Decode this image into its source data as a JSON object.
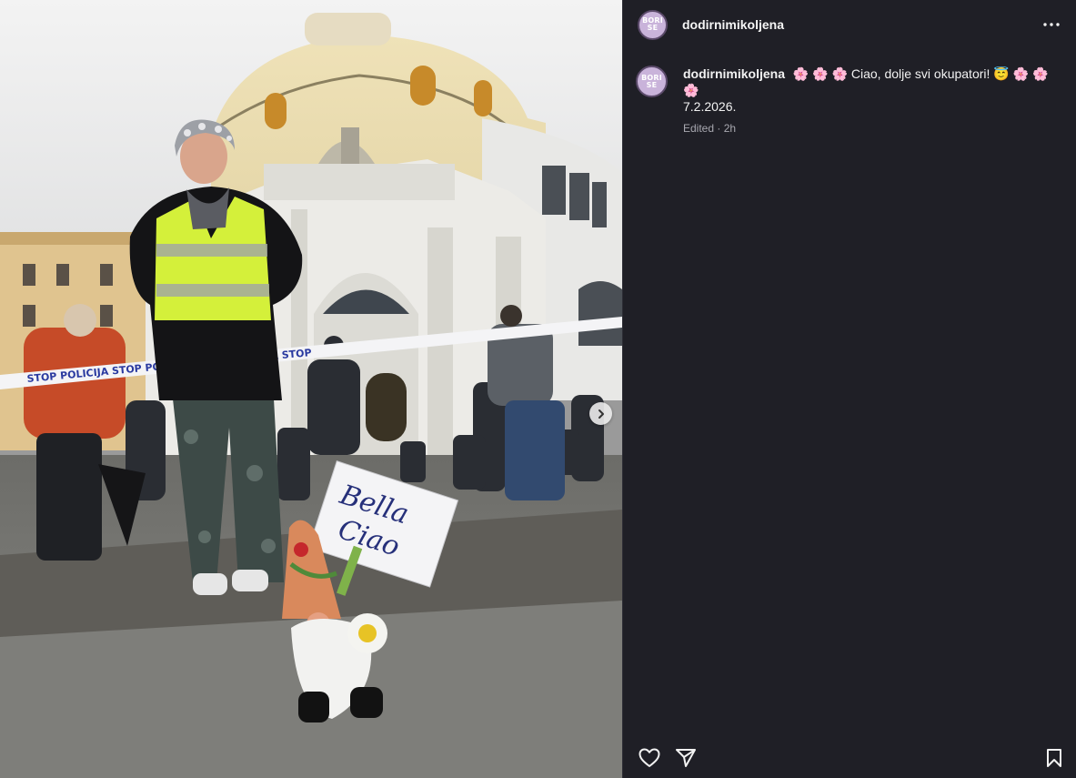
{
  "post": {
    "username": "dodirnimikoljena",
    "avatar_text": [
      "BORI",
      "SE"
    ],
    "caption": {
      "emoji_prefix": "🌸 🌸 🌸",
      "text": "Ciao, dolje svi okupatori!",
      "emoji_suffix": "😇 🌸 🌸",
      "emoji_line2": "🌸",
      "date": "7.2.2026."
    },
    "edited_label": "Edited",
    "time_ago": "2h"
  },
  "photo": {
    "sign_text_line1": "Bella",
    "sign_text_line2": "Ciao",
    "tape_text": "STOP POLICIJA STOP POLICIJA STOP POLICIJA STOP"
  },
  "icons": {
    "more": "more-dots-icon",
    "next": "chevron-right-icon",
    "like": "heart-icon",
    "share": "send-icon",
    "save": "bookmark-icon"
  },
  "colors": {
    "panel_bg": "#1f1f26",
    "text": "#f2f2f2",
    "muted": "#a8a8b0",
    "accent_flower": "#ff6fa8",
    "vest": "#d4f03a"
  }
}
